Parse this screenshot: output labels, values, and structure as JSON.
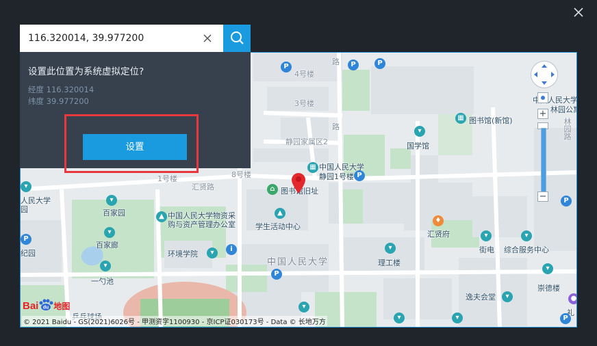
{
  "window": {
    "close_icon": "close-icon"
  },
  "search": {
    "value": "116.320014, 39.977200",
    "clear_icon": "clear-icon",
    "search_icon": "search-icon",
    "accent": "#1a9be0"
  },
  "popup": {
    "question": "设置此位置为系统虚拟定位?",
    "longitude": "经度 116.320014",
    "latitude": "纬度 39.977200",
    "confirm_label": "设置",
    "highlight_color": "#e9373e"
  },
  "map": {
    "labels": {
      "lou4": "4号楼",
      "lou3": "3号楼",
      "lou8": "8号楼",
      "lou1": "1号楼",
      "jingyuan": "静园",
      "jingyuan_east": "静园家属区2",
      "lu1": "路",
      "lu2": "路",
      "huixian_road": "汇贤路",
      "renda_top": "中国人民大学",
      "jingyuan1": "静园1号楼",
      "library_old": "图书馆旧址",
      "library_new": "图书馆(新馆)",
      "guoxue": "国学馆",
      "renda_right": "中国人民大学",
      "xiyuan_gong": "林园公寓",
      "lin_yuan": "林园路",
      "jia_zu": "人民大学",
      "yuan": "园",
      "baijiayuan": "百家园",
      "baijialang": "百家廊",
      "material_mgmt": "中国人民大学物资采",
      "material_mgmt2": "购与资产管理办公室",
      "student_center": "学生活动中心",
      "huixianfu": "汇贤府",
      "environment": "环境学院",
      "renda_center": "中国人民大学",
      "ligong": "理工楼",
      "jiedian": "街电",
      "general_service": "综合服务中心",
      "yishao": "一勺池",
      "jiyuan": "纪园",
      "chongde": "崇德楼",
      "yifu_hall": "逸夫会堂",
      "li": "礼",
      "sports": "乒乓球场"
    },
    "brand": {
      "baidu": "Bai",
      "du": "du",
      "map_text": "地图"
    },
    "copyright": "© 2021 Baidu - GS(2021)6026号 - 甲测资字1100930 - 京ICP证030173号 - Data © 长地万方",
    "zoom": {
      "plus": "+",
      "minus": "−"
    },
    "pin_color": "#e3282e"
  }
}
